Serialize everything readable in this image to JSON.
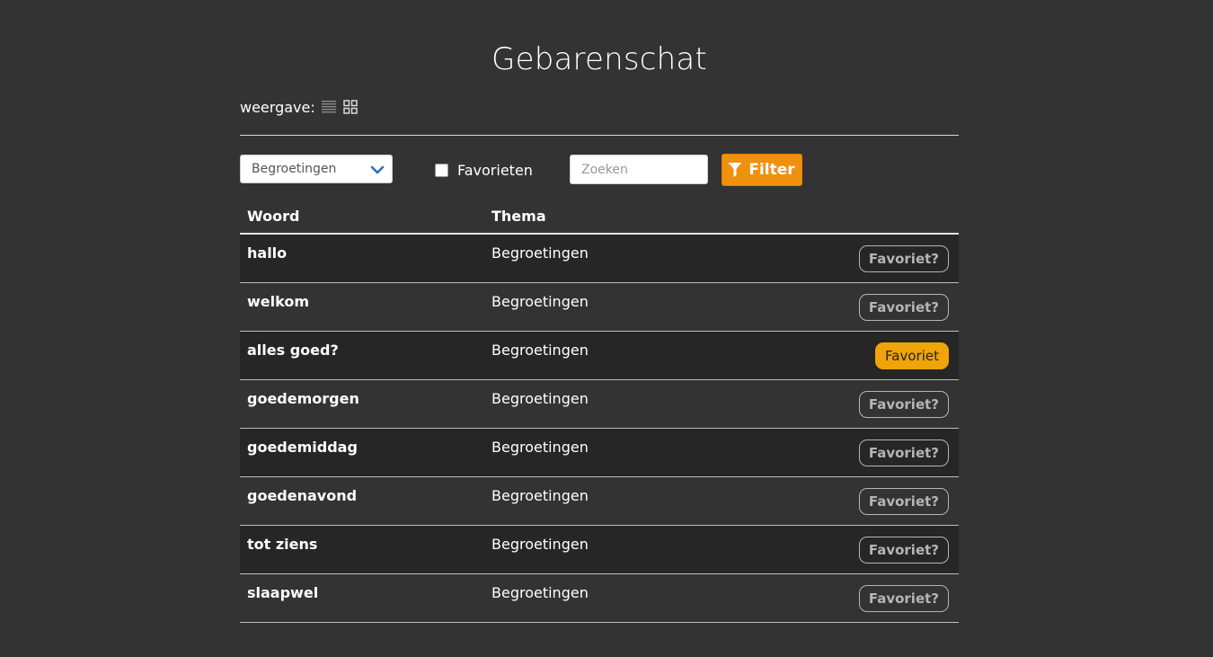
{
  "header": {
    "title": "Gebarenschat"
  },
  "view": {
    "label": "weergave:",
    "icons": [
      "list-view-icon",
      "grid-view-icon"
    ]
  },
  "filters": {
    "theme_selected": "Begroetingen",
    "favorites_label": "Favorieten",
    "favorites_checked": false,
    "search_placeholder": "Zoeken",
    "search_value": "",
    "filter_label": "Filter"
  },
  "table": {
    "headers": {
      "word": "Woord",
      "theme": "Thema"
    },
    "rows": [
      {
        "word": "hallo",
        "theme": "Begroetingen",
        "favorite": false,
        "button": "Favoriet?"
      },
      {
        "word": "welkom",
        "theme": "Begroetingen",
        "favorite": false,
        "button": "Favoriet?"
      },
      {
        "word": "alles goed?",
        "theme": "Begroetingen",
        "favorite": true,
        "button": "Favoriet"
      },
      {
        "word": "goedemorgen",
        "theme": "Begroetingen",
        "favorite": false,
        "button": "Favoriet?"
      },
      {
        "word": "goedemiddag",
        "theme": "Begroetingen",
        "favorite": false,
        "button": "Favoriet?"
      },
      {
        "word": "goedenavond",
        "theme": "Begroetingen",
        "favorite": false,
        "button": "Favoriet?"
      },
      {
        "word": "tot ziens",
        "theme": "Begroetingen",
        "favorite": false,
        "button": "Favoriet?"
      },
      {
        "word": "slaapwel",
        "theme": "Begroetingen",
        "favorite": false,
        "button": "Favoriet?"
      }
    ]
  },
  "colors": {
    "background": "#333333",
    "accent": "#f0900f",
    "favorite_active": "#f0a30a"
  }
}
